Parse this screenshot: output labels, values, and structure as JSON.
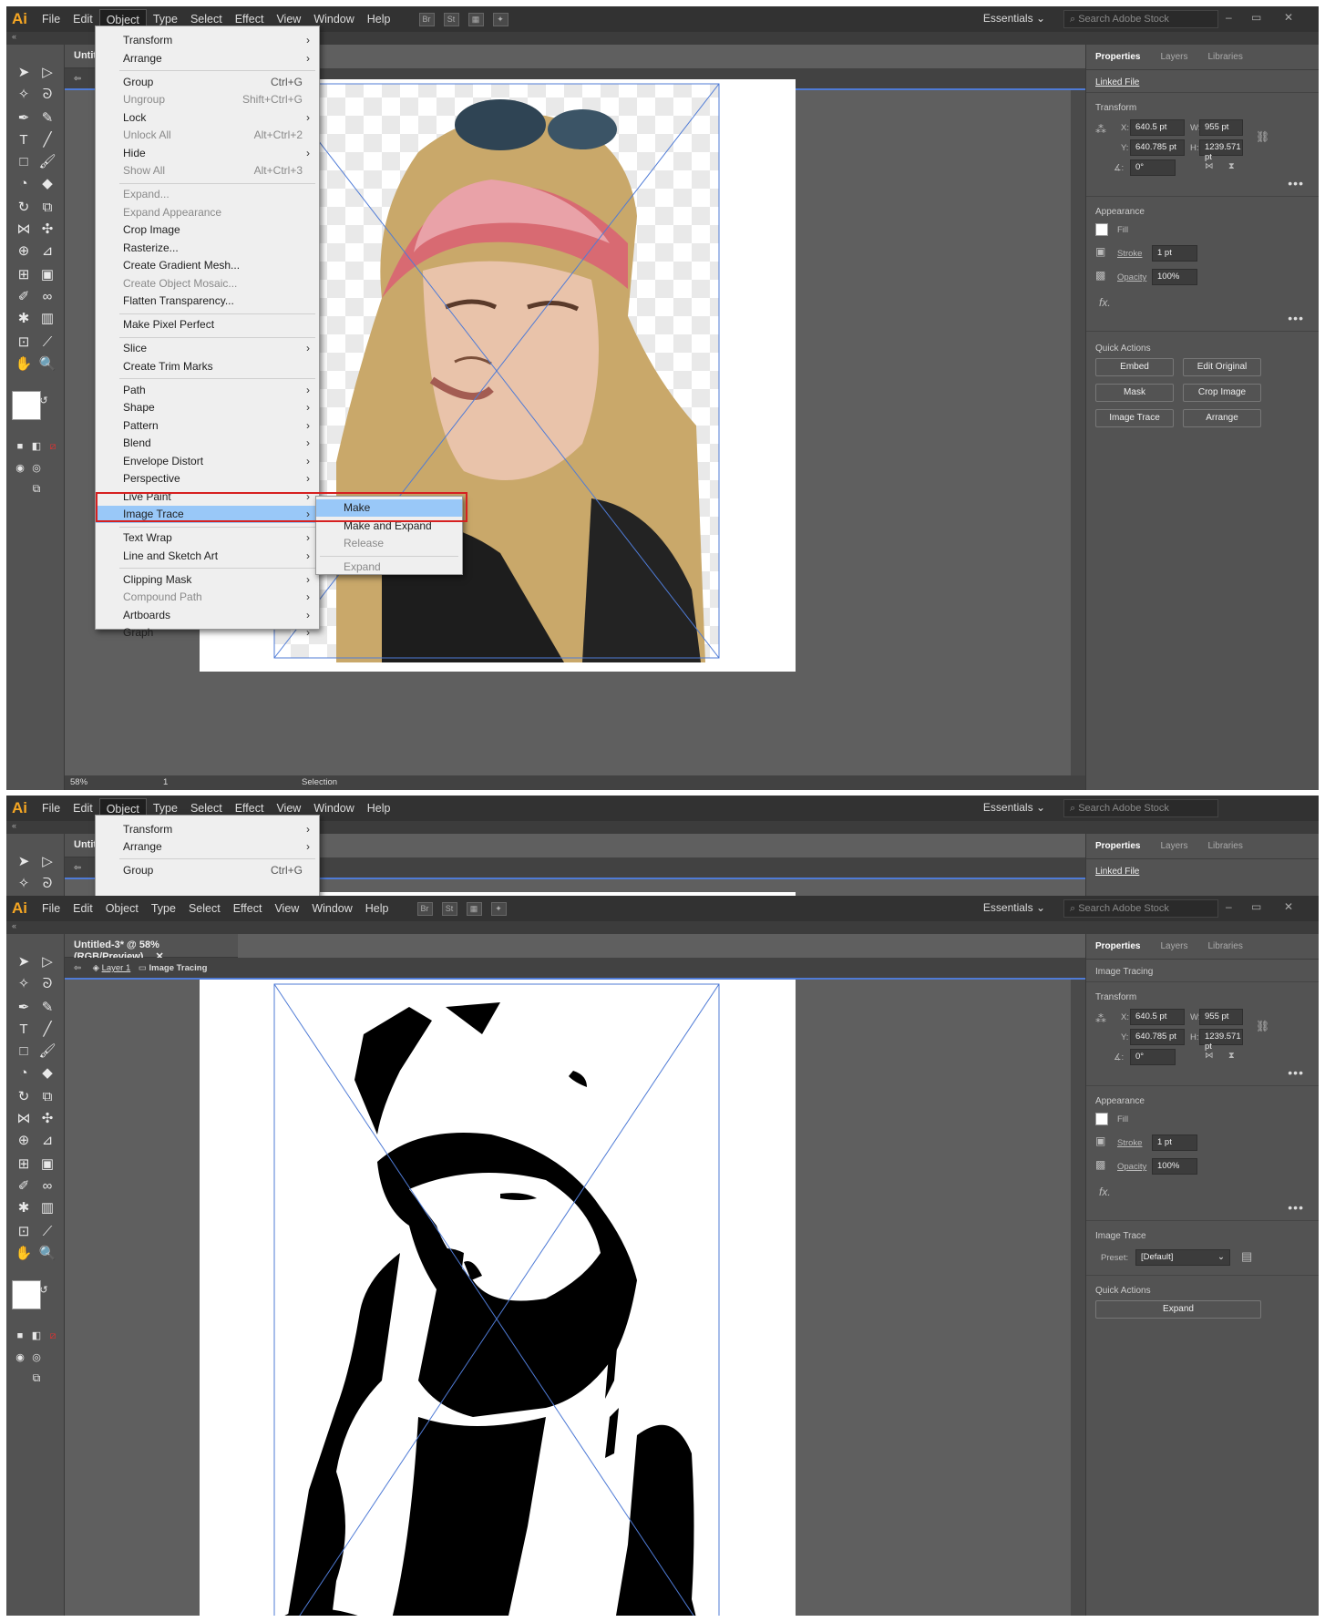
{
  "app": {
    "logo": "Ai",
    "workspace": "Essentials",
    "search_placeholder": "Search Adobe Stock"
  },
  "menubar": [
    "File",
    "Edit",
    "Object",
    "Type",
    "Select",
    "Effect",
    "View",
    "Window",
    "Help"
  ],
  "toolbar_icons": [
    "Br",
    "St"
  ],
  "window_controls": {
    "minimize": "–",
    "restore": "▭",
    "close": "✕"
  },
  "panel": {
    "tabs": [
      "Properties",
      "Layers",
      "Libraries"
    ],
    "top1": "Linked File",
    "top2": "Image Tracing",
    "transform_title": "Transform",
    "x_label": "X:",
    "x_value": "640.5 pt",
    "y_label": "Y:",
    "y_value": "640.785 pt",
    "w_label": "W:",
    "w_value": "955 pt",
    "h_label": "H:",
    "h_value": "1239.571 pt",
    "angle_value": "0°",
    "appearance_title": "Appearance",
    "fill_label": "Fill",
    "stroke_label": "Stroke",
    "stroke_value": "1 pt",
    "opacity_label": "Opacity",
    "opacity_value": "100%",
    "fx_label": "fx.",
    "quick_actions_title": "Quick Actions",
    "quick_actions": [
      "Embed",
      "Edit Original",
      "Mask",
      "Crop Image",
      "Image Trace",
      "Arrange"
    ],
    "image_trace_title": "Image Trace",
    "preset_label": "Preset:",
    "preset_value": "[Default]",
    "expand_button": "Expand"
  },
  "doc": {
    "tab_short": "Untitl",
    "tab_full": "Untitled-3* @ 58% (RGB/Preview)",
    "close": "✕",
    "layer": "Layer 1",
    "object": "Image Tracing",
    "zoom": "58%",
    "artboard": "1",
    "status": "Selection"
  },
  "object_menu": [
    {
      "label": "Transform",
      "sc": "",
      "sub": true,
      "dis": false
    },
    {
      "label": "Arrange",
      "sc": "",
      "sub": true,
      "dis": false
    },
    {
      "label": "Group",
      "sc": "Ctrl+G",
      "sub": false,
      "dis": false
    },
    {
      "label": "Ungroup",
      "sc": "Shift+Ctrl+G",
      "sub": false,
      "dis": true
    },
    {
      "label": "Lock",
      "sc": "",
      "sub": true,
      "dis": false
    },
    {
      "label": "Unlock All",
      "sc": "Alt+Ctrl+2",
      "sub": false,
      "dis": true
    },
    {
      "label": "Hide",
      "sc": "",
      "sub": true,
      "dis": false
    },
    {
      "label": "Show All",
      "sc": "Alt+Ctrl+3",
      "sub": false,
      "dis": true
    },
    {
      "label": "Expand...",
      "sc": "",
      "sub": false,
      "dis": true
    },
    {
      "label": "Expand Appearance",
      "sc": "",
      "sub": false,
      "dis": true
    },
    {
      "label": "Crop Image",
      "sc": "",
      "sub": false,
      "dis": false
    },
    {
      "label": "Rasterize...",
      "sc": "",
      "sub": false,
      "dis": false
    },
    {
      "label": "Create Gradient Mesh...",
      "sc": "",
      "sub": false,
      "dis": false
    },
    {
      "label": "Create Object Mosaic...",
      "sc": "",
      "sub": false,
      "dis": true
    },
    {
      "label": "Flatten Transparency...",
      "sc": "",
      "sub": false,
      "dis": false
    },
    {
      "label": "Make Pixel Perfect",
      "sc": "",
      "sub": false,
      "dis": false
    },
    {
      "label": "Slice",
      "sc": "",
      "sub": true,
      "dis": false
    },
    {
      "label": "Create Trim Marks",
      "sc": "",
      "sub": false,
      "dis": false
    },
    {
      "label": "Path",
      "sc": "",
      "sub": true,
      "dis": false
    },
    {
      "label": "Shape",
      "sc": "",
      "sub": true,
      "dis": false
    },
    {
      "label": "Pattern",
      "sc": "",
      "sub": true,
      "dis": false
    },
    {
      "label": "Blend",
      "sc": "",
      "sub": true,
      "dis": false
    },
    {
      "label": "Envelope Distort",
      "sc": "",
      "sub": true,
      "dis": false
    },
    {
      "label": "Perspective",
      "sc": "",
      "sub": true,
      "dis": false
    },
    {
      "label": "Live Paint",
      "sc": "",
      "sub": true,
      "dis": false
    },
    {
      "label": "Image Trace",
      "sc": "",
      "sub": true,
      "dis": false
    },
    {
      "label": "Text Wrap",
      "sc": "",
      "sub": true,
      "dis": false
    },
    {
      "label": "Line and Sketch Art",
      "sc": "",
      "sub": true,
      "dis": false
    },
    {
      "label": "Clipping Mask",
      "sc": "",
      "sub": true,
      "dis": false
    },
    {
      "label": "Compound Path",
      "sc": "",
      "sub": true,
      "dis": true
    },
    {
      "label": "Artboards",
      "sc": "",
      "sub": true,
      "dis": false
    },
    {
      "label": "Graph",
      "sc": "",
      "sub": true,
      "dis": false
    }
  ],
  "trace_submenu": [
    {
      "label": "Make",
      "dis": false
    },
    {
      "label": "Make and Expand",
      "dis": false
    },
    {
      "label": "Release",
      "dis": true
    },
    {
      "label": "Expand",
      "dis": true
    }
  ],
  "colors": {
    "accent": "#99c8f8",
    "highlight_box": "#d62020",
    "brand": "#f5a623",
    "selection": "#4f7bd6"
  }
}
